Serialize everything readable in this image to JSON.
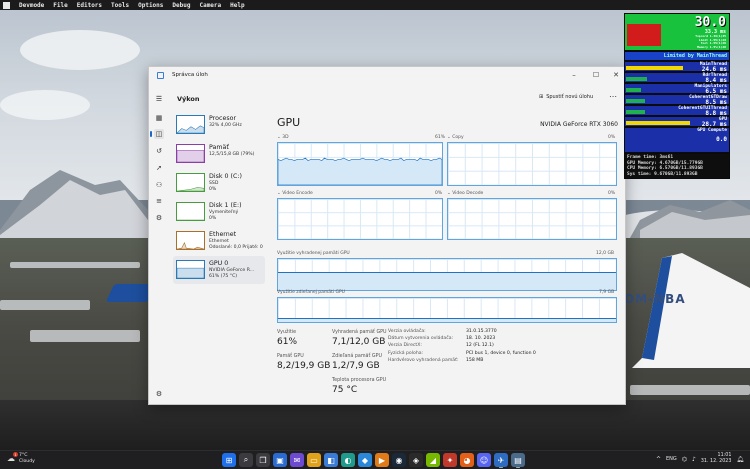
{
  "devmode_menu": [
    "Devmode",
    "File",
    "Editors",
    "Tools",
    "Options",
    "Debug",
    "Camera",
    "Help"
  ],
  "hud": {
    "fps": "30.0",
    "frame_ms": "33.3 ms",
    "detail_lines": [
      "Topcord 1.39(1)35",
      "Limit 1.55(1)20",
      "Tool 1.55(1)20",
      "Memory 1.5%(1)20"
    ],
    "limit": "Limited by MainThread",
    "rows": [
      {
        "label": "MainThread",
        "value": "24.6 ms",
        "color": "#f0d800",
        "fill": 0.55
      },
      {
        "label": "RdrThread",
        "value": "8.4 ms",
        "color": "#20b050",
        "fill": 0.2
      },
      {
        "label": "Manipulators",
        "value": "6.5 ms",
        "color": "#20b050",
        "fill": 0.14
      },
      {
        "label": "CoherentGTDraw",
        "value": "8.5 ms",
        "color": "#20b050",
        "fill": 0.18
      },
      {
        "label": "CoherentGTUIThread",
        "value": "8.8 ms",
        "color": "#20b050",
        "fill": 0.18
      },
      {
        "label": "GPU",
        "value": "28.7 ms",
        "color": "#f0d800",
        "fill": 0.62
      }
    ],
    "gpu_compute": "GPU Compute",
    "gpu_compute_value": "0.0",
    "mem_lines": [
      "Frame time: 3ms61",
      "GPU Memory: 4.670GB/15.779GB",
      "CPU Memory: 6.570GB/11.893GB",
      "Sys time: 9.670GB/11.893GB"
    ]
  },
  "window": {
    "title": "Správca úloh",
    "section": "Výkon",
    "new_task": "Spustiť novú úlohu"
  },
  "nav_icons": [
    "menu-icon",
    "processes-icon",
    "performance-icon",
    "app-history-icon",
    "startup-apps-icon",
    "users-icon",
    "details-icon",
    "services-icon",
    "settings-icon"
  ],
  "sidebar": [
    {
      "name": "Procesor",
      "line1": "32% 4,00 GHz",
      "line2": "",
      "color": "#2a7ab8"
    },
    {
      "name": "Pamäť",
      "line1": "12,5/15,8 GB (79%)",
      "line2": "",
      "color": "#8a3fa6"
    },
    {
      "name": "Disk 0 (C:)",
      "line1": "SSD",
      "line2": "0%",
      "color": "#4a9b3f"
    },
    {
      "name": "Disk 1 (E:)",
      "line1": "Vymeniteľný",
      "line2": "0%",
      "color": "#4a9b3f"
    },
    {
      "name": "Ethernet",
      "line1": "Ethernet",
      "line2": "Odoslané: 0,0 Prijaté: 0",
      "color": "#a8702a"
    },
    {
      "name": "GPU 0",
      "line1": "NVIDIA GeForce R...",
      "line2": "61% (75 °C)",
      "color": "#2a7ab8"
    }
  ],
  "gpu": {
    "title": "GPU",
    "model": "NVIDIA GeForce RTX 3060",
    "engines": [
      {
        "name": "3D",
        "pct": "61%"
      },
      {
        "name": "Copy",
        "pct": "0%"
      },
      {
        "name": "Video Encode",
        "pct": "0%"
      },
      {
        "name": "Video Decode",
        "pct": "0%"
      }
    ],
    "dedicated_label": "Využitie vyhradenej pamäti GPU",
    "dedicated_max": "12,0 GB",
    "shared_label": "Využitie zdieľanej pamäti GPU",
    "shared_max": "7,9 GB"
  },
  "stats": {
    "utilization_label": "Využitie",
    "utilization_value": "61%",
    "dedicated_label": "Vyhradená pamäť GPU",
    "dedicated_value": "7,1/12,0 GB",
    "gpu_memory_label": "Pamäť GPU",
    "gpu_memory_value": "8,2/19,9 GB",
    "shared_label": "Zdieľaná pamäť GPU",
    "shared_value": "1,2/7,9 GB",
    "temp_label": "Teplota procesora GPU",
    "temp_value": "75 °C"
  },
  "properties": [
    {
      "key": "Verzia ovládača:",
      "value": "31.0.15.3770"
    },
    {
      "key": "Dátum vytvorenia ovládača:",
      "value": "18. 10. 2023"
    },
    {
      "key": "Verzia DirectX:",
      "value": "12 (FL 12.1)"
    },
    {
      "key": "Fyzická poloha:",
      "value": "PCI bus 1, device 0, function 0"
    },
    {
      "key": "Hardvérovo vyhradená pamäť:",
      "value": "158 MB"
    }
  ],
  "taskbar": {
    "temperature": "7°C",
    "weather": "Cloudy",
    "badge": "1",
    "apps": [
      "windows-start-icon",
      "search-icon",
      "task-view-icon",
      "widgets-icon",
      "chat-icon",
      "file-explorer-icon",
      "store-icon",
      "edge-icon",
      "app-icon",
      "media-player-icon",
      "steam-icon",
      "epic-icon",
      "nvidia-icon",
      "game-icon",
      "firefox-icon",
      "discord-icon",
      "flight-simulator-icon",
      "task-manager-icon"
    ],
    "language": "ENG",
    "time": "11:01",
    "date": "31. 12. 2023"
  }
}
